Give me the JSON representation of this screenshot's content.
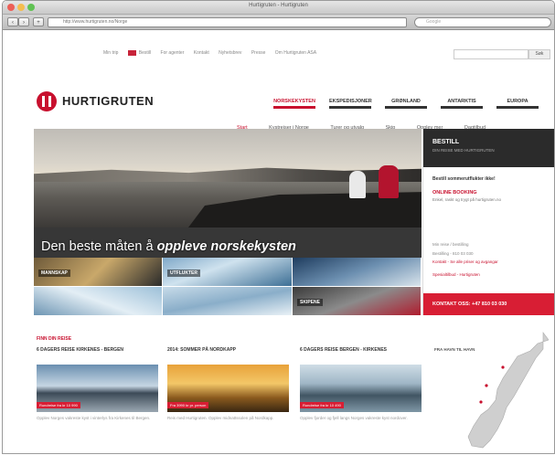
{
  "window": {
    "title": "Hurtigruten - Hurtigruten",
    "url": "http://www.hurtigruten.no/Norge",
    "search_placeholder": "Google"
  },
  "topnav": {
    "items": [
      "Min trip",
      "Bestill",
      "For agenter",
      "Kontakt",
      "Nyhetsbrev",
      "Presse",
      "Om Hurtigruten ASA"
    ],
    "search_button": "Søk"
  },
  "logo": {
    "text": "HURTIGRUTEN"
  },
  "main_nav": [
    "NORSKEKYSTEN",
    "EKSPEDISJONER",
    "GRØNLAND",
    "ANTARKTIS",
    "EUROPA"
  ],
  "sub_nav": [
    "Start",
    "Kystreiser i Norge",
    "Turer og utvalg",
    "Skip",
    "Opplev mer",
    "Dagtilbud"
  ],
  "hero": {
    "caption_prefix": "Den beste måten å ",
    "caption_emph": "oppleve norskekysten",
    "tiles": [
      "MANNSKAP",
      "UTFLUKTER",
      "",
      "",
      "",
      "SKIPENE"
    ]
  },
  "booking": {
    "title": "BESTILL",
    "subtitle": "DIN REISE MED HURTIGRUTEN",
    "question": "Bestill sommerutflukter ikke!",
    "online_label": "ONLINE BOOKING",
    "online_desc": "Enkel, raskt og trygt på hurtigruten.no",
    "lines": [
      "Min reise / bestilling",
      "Bestilling - 810 03 030"
    ],
    "links": [
      "Kontakt - Se alle priser og avgangar",
      "Spesialtilbud - Hurtigruten"
    ],
    "contact": "KONTAKT OSS: +47 810 03 030"
  },
  "trips": {
    "heading": "FINN DIN REISE",
    "items": [
      {
        "title": "6 DAGERS REISE KIRKENES - BERGEN",
        "tag": "Rundreise fra kr 10 990",
        "desc": "Opplev Norges vakreste kyst i vinterlys fra Kirkenes til Bergen."
      },
      {
        "title": "2014: SOMMER PÅ NORDKAPP",
        "tag": "Fra 3990 kr pr. person",
        "desc": "Reis med Hurtigruten. Opplev midnattssolen på Nordkapp."
      },
      {
        "title": "6 DAGERS REISE BERGEN - KIRKENES",
        "tag": "Rundreise fra kr 10 490",
        "desc": "Opplev fjorder og fjell langs Norges vakreste kyst nordover."
      }
    ],
    "map_title": "FRA HAVN TIL HAVN"
  },
  "colors": {
    "brand_red": "#c8102e",
    "dark_band": "#2b2b2b"
  }
}
